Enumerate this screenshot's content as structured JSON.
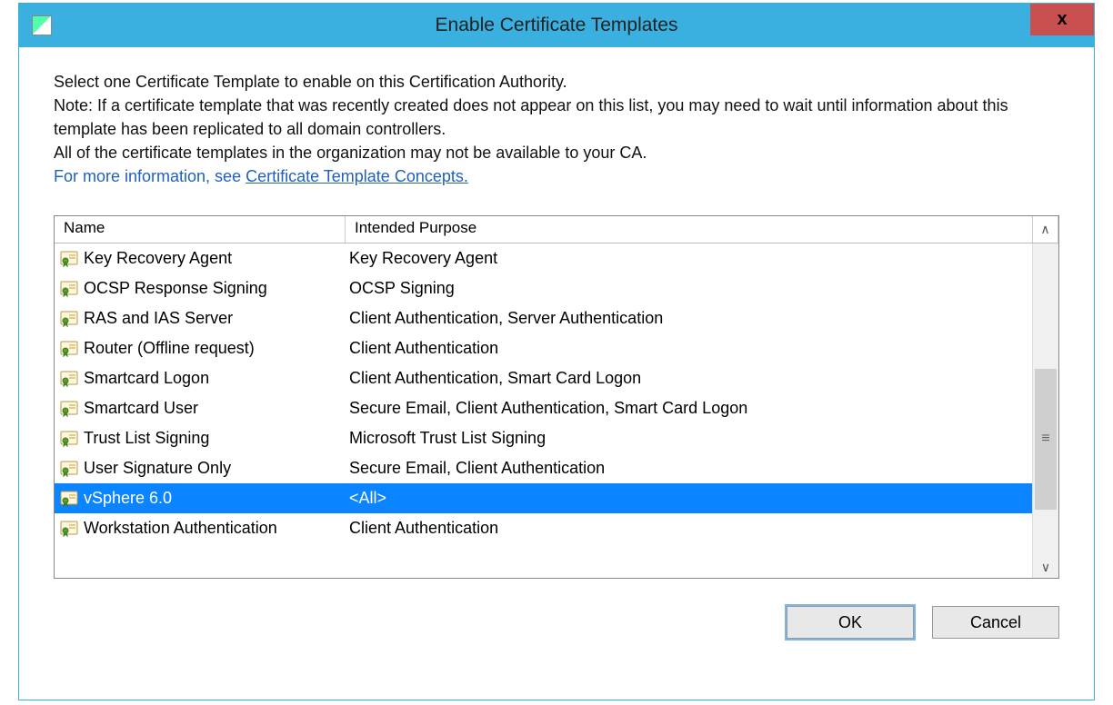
{
  "window": {
    "title": "Enable Certificate Templates",
    "close_label": "x"
  },
  "instructions": {
    "line1": "Select one Certificate Template to enable on this Certification Authority.",
    "line2": "Note: If a certificate template that was recently created does not appear on this list, you may need to wait until information about this template has been replicated to all domain controllers.",
    "line3": "All of the certificate templates in the organization may not be available to your CA.",
    "more_prefix": "For more information, see ",
    "more_link": "Certificate Template Concepts."
  },
  "columns": {
    "name": "Name",
    "purpose": "Intended Purpose"
  },
  "templates": [
    {
      "name": "Key Recovery Agent",
      "purpose": "Key Recovery Agent",
      "selected": false
    },
    {
      "name": "OCSP Response Signing",
      "purpose": "OCSP Signing",
      "selected": false
    },
    {
      "name": "RAS and IAS Server",
      "purpose": "Client Authentication, Server Authentication",
      "selected": false
    },
    {
      "name": "Router (Offline request)",
      "purpose": "Client Authentication",
      "selected": false
    },
    {
      "name": "Smartcard Logon",
      "purpose": "Client Authentication, Smart Card Logon",
      "selected": false
    },
    {
      "name": "Smartcard User",
      "purpose": "Secure Email, Client Authentication, Smart Card Logon",
      "selected": false
    },
    {
      "name": "Trust List Signing",
      "purpose": "Microsoft Trust List Signing",
      "selected": false
    },
    {
      "name": "User Signature Only",
      "purpose": "Secure Email, Client Authentication",
      "selected": false
    },
    {
      "name": "vSphere 6.0",
      "purpose": "<All>",
      "selected": true
    },
    {
      "name": "Workstation Authentication",
      "purpose": "Client Authentication",
      "selected": false
    }
  ],
  "buttons": {
    "ok": "OK",
    "cancel": "Cancel"
  },
  "scroll": {
    "up": "∧",
    "down": "∨",
    "thumb": "≡"
  }
}
